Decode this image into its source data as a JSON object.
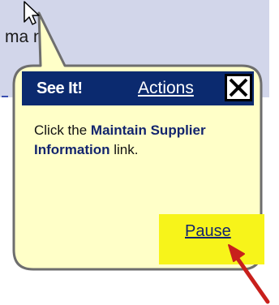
{
  "underlay": {
    "fragment_text": "ma   n"
  },
  "callout": {
    "title": "See It!",
    "actions_label": "Actions",
    "instruction_prefix": "Click the ",
    "instruction_target": "Maintain Supplier Information",
    "instruction_suffix": " link.",
    "pause_label": "Pause"
  },
  "icons": {
    "close": "close-icon",
    "pointer": "mouse-pointer-icon",
    "annotation": "red-arrow-icon"
  },
  "colors": {
    "background_panel": "#d2d6ea",
    "callout_fill": "#ffffc8",
    "header_bar": "#0b2a6f",
    "link_text": "#13256e",
    "highlight": "#f7f41a",
    "annotation_arrow": "#c8201c"
  }
}
